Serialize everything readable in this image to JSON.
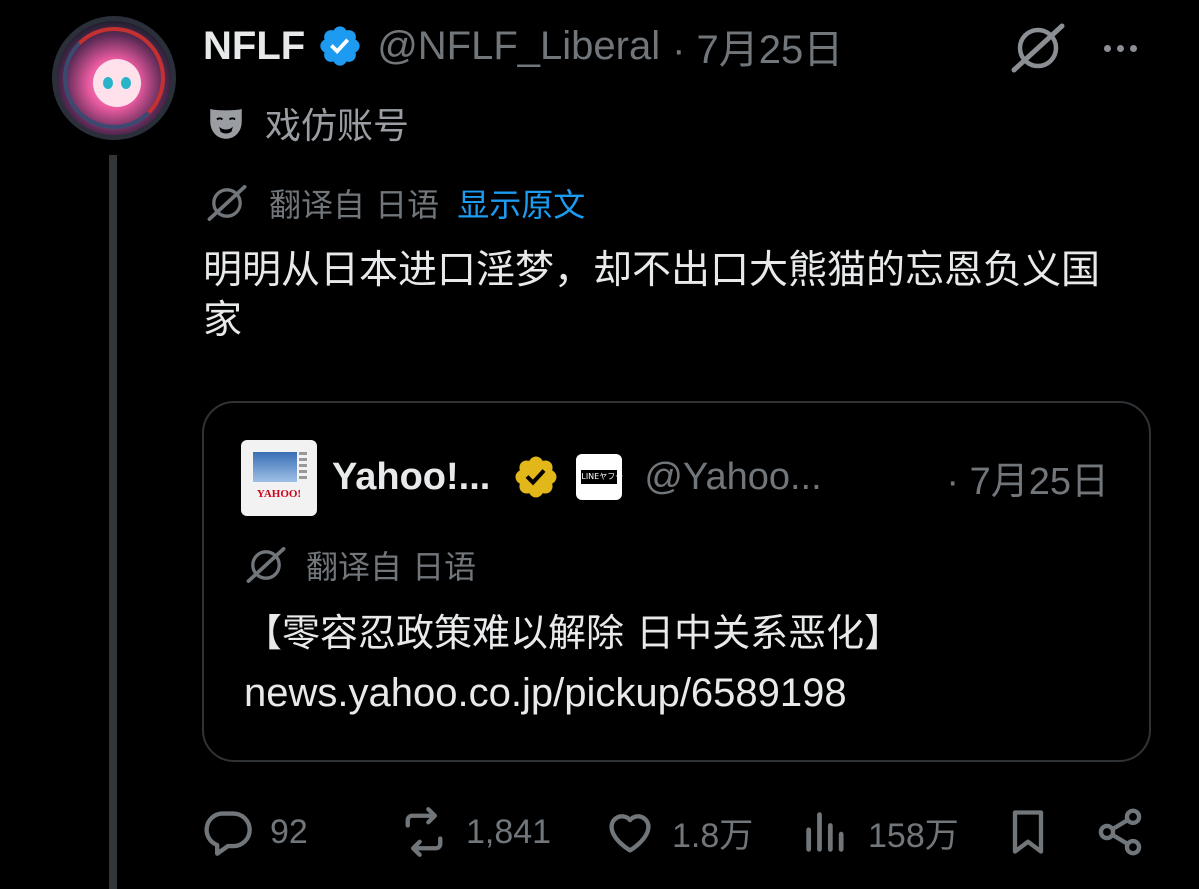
{
  "tweet": {
    "display_name": "NFLF",
    "handle": "@NFLF_Liberal",
    "date": "· 7月25日",
    "parody_label": "戏仿账号",
    "translated_from": "翻译自 日语",
    "show_original": "显示原文",
    "text": "明明从日本进口淫梦，却不出口大熊猫的忘恩负义国家"
  },
  "quote": {
    "display_name": "Yahoo!...",
    "badge_text": "LINEヤフー",
    "handle": "@Yahoo...",
    "date": "· 7月25日",
    "avatar_logo": "YAHOO!",
    "translated_from": "翻译自 日语",
    "headline": "【零容忍政策难以解除 日中关系恶化】",
    "link": "news.yahoo.co.jp/pickup/6589198"
  },
  "actions": {
    "replies": "92",
    "reposts": "1,841",
    "likes": "1.8万",
    "views": "158万"
  },
  "icons": {
    "verified_color": "#1d9bf0",
    "org_verified_color": "#e2b719",
    "link_color": "#1d9bf0"
  }
}
